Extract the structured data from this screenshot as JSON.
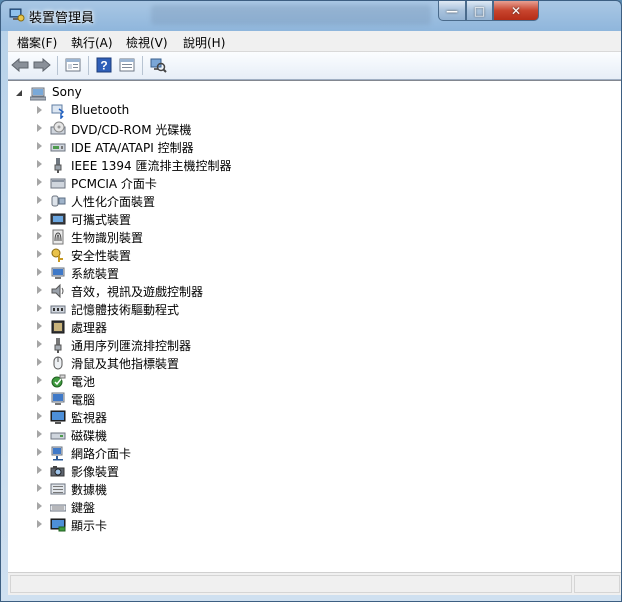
{
  "window": {
    "title": "裝置管理員"
  },
  "menu": {
    "items": [
      "檔案(F)",
      "執行(A)",
      "檢視(V)",
      "說明(H)"
    ]
  },
  "toolbar": {
    "buttons": [
      "back-icon",
      "forward-icon",
      "properties-icon",
      "help-icon",
      "view-icon",
      "scan-hardware-icon"
    ]
  },
  "tree": {
    "root": "Sony",
    "items": [
      {
        "label": "Bluetooth",
        "icon": "bluetooth-icon"
      },
      {
        "label": "DVD/CD-ROM 光碟機",
        "icon": "dvd-icon"
      },
      {
        "label": "IDE ATA/ATAPI 控制器",
        "icon": "ide-icon"
      },
      {
        "label": "IEEE 1394 匯流排主機控制器",
        "icon": "ieee1394-icon"
      },
      {
        "label": "PCMCIA 介面卡",
        "icon": "pcmcia-icon"
      },
      {
        "label": "人性化介面裝置",
        "icon": "hid-icon"
      },
      {
        "label": "可攜式裝置",
        "icon": "portable-device-icon"
      },
      {
        "label": "生物識別裝置",
        "icon": "fingerprint-icon"
      },
      {
        "label": "安全性裝置",
        "icon": "security-key-icon"
      },
      {
        "label": "系統裝置",
        "icon": "system-device-icon"
      },
      {
        "label": "音效，視訊及遊戲控制器",
        "icon": "speaker-icon"
      },
      {
        "label": "記憶體技術驅動程式",
        "icon": "memory-icon"
      },
      {
        "label": "處理器",
        "icon": "cpu-icon"
      },
      {
        "label": "通用序列匯流排控制器",
        "icon": "usb-icon"
      },
      {
        "label": "滑鼠及其他指標裝置",
        "icon": "mouse-icon"
      },
      {
        "label": "電池",
        "icon": "battery-icon"
      },
      {
        "label": "電腦",
        "icon": "computer-icon"
      },
      {
        "label": "監視器",
        "icon": "monitor-icon"
      },
      {
        "label": "磁碟機",
        "icon": "disk-drive-icon"
      },
      {
        "label": "網路介面卡",
        "icon": "network-adapter-icon"
      },
      {
        "label": "影像裝置",
        "icon": "camera-icon"
      },
      {
        "label": "數據機",
        "icon": "modem-icon"
      },
      {
        "label": "鍵盤",
        "icon": "keyboard-icon"
      },
      {
        "label": "顯示卡",
        "icon": "display-adapter-icon"
      }
    ]
  }
}
